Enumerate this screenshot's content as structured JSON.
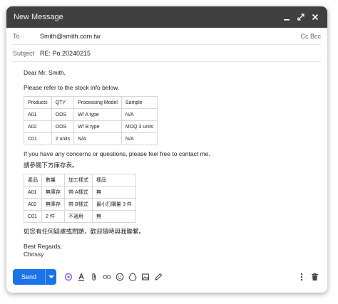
{
  "window": {
    "title": "New Message"
  },
  "to": {
    "label": "To",
    "value": "Smith@smith.com.tw",
    "cc_bcc": "Cc Bcc"
  },
  "subject": {
    "label": "Subject",
    "value": "RE: Po.20240215"
  },
  "body": {
    "greeting": "Dear Mr. Smith,",
    "intro": "Please refer to the stock info below.",
    "table_en": {
      "headers": [
        "Products",
        "QTY",
        "Processing Model",
        "Sample"
      ],
      "rows": [
        [
          "A01",
          "OOS",
          "W/ A type",
          "N/A"
        ],
        [
          "A02",
          "OOS",
          "W/ B type",
          "MOQ 3 units"
        ],
        [
          "C01",
          "2 units",
          "N/A",
          "N/A"
        ]
      ]
    },
    "concerns": "If you have any concerns or questions, please feel free to contact me.",
    "intro_zh": "請參閱下方庫存表。",
    "table_zh": {
      "headers": [
        "產品",
        "數量",
        "加工樣式",
        "樣品"
      ],
      "rows": [
        [
          "A01",
          "無庫存",
          "帶 A樣式",
          "無"
        ],
        [
          "A02",
          "無庫存",
          "帶 B樣式",
          "最小訂購量 3 件"
        ],
        [
          "C01",
          "2 件",
          "不適用",
          "無"
        ]
      ]
    },
    "concerns_zh": "如您有任何疑慮或問題，歡迎隨時與我聯繫。",
    "closing": "Best Regards,",
    "signature": "Chrissy"
  },
  "toolbar": {
    "send_label": "Send"
  },
  "colors": {
    "send": "#1a73e8",
    "titlebar": "#404040"
  }
}
